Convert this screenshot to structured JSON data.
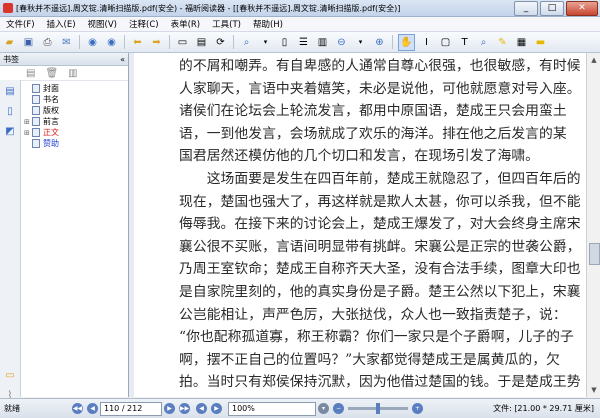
{
  "window": {
    "title": "[春秋并不遥远].周文锭.清晰扫描版.pdf(安全) - 福昕阅读器 - [[春秋并不遥远].周文锭.清晰扫描版.pdf(安全)]",
    "min": "_",
    "max": "□",
    "close": "✕"
  },
  "menu": [
    "文件(F)",
    "插入(E)",
    "视图(V)",
    "注释(C)",
    "表单(R)",
    "工具(T)",
    "帮助(H)"
  ],
  "sidebar": {
    "title": "书签",
    "close": "«",
    "bookmarks": [
      {
        "label": "封面",
        "color": "#000"
      },
      {
        "label": "书名",
        "color": "#000"
      },
      {
        "label": "版权",
        "color": "#000"
      },
      {
        "label": "前言",
        "color": "#000"
      },
      {
        "label": "正文",
        "color": "#d21e1e"
      },
      {
        "label": "赞助",
        "color": "#1c3fd1"
      }
    ]
  },
  "document": {
    "lines": [
      "的不屑和嘲弄。有自卑感的人通常自尊心很强，也很敏感，有时候",
      "人家聊天，言语中夹着嬉笑，未必是说他，可他就愿意对号入座。",
      "诸侯们在论坛会上轮流发言，都用中原国语，楚成王只会用蛮土",
      "语，一到他发言，会场就成了欢乐的海洋。排在他之后发言的某",
      "国君居然还模仿他的几个切口和发言，在现场引发了海啸。",
      "　　这场面要是发生在四百年前，楚成王就隐忍了，但四百年后的",
      "现在，楚国也强大了，再这样就是欺人太甚，你可以杀我，但不能",
      "侮辱我。在接下来的讨论会上，楚成王爆发了，对大会终身主席宋",
      "襄公很不买账，言语间明显带有挑衅。宋襄公是正宗的世袭公爵，",
      "乃周王室钦命；楚成王自称齐天大圣，没有合法手续，图章大印也",
      "是自家院里刻的，他的真实身份是子爵。楚王公然以下犯上，宋襄",
      "公岂能相让，声严色厉，大张挞伐，众人也一致指责楚子，说：",
      "“你也配称孤道寡，称王称霸？你们一家只是个子爵啊，儿子的子",
      "啊，摆不正自己的位置吗？”大家都觉得楚成王是属黄瓜的，欠",
      "拍。当时只有郑侯保持沉默，因为他借过楚国的钱。于是楚成王势"
    ]
  },
  "status": {
    "left": "就绪",
    "page": "110 / 212",
    "zoom": "100%",
    "doc_size": "文件: [21.00 * 29.71 厘米]"
  }
}
